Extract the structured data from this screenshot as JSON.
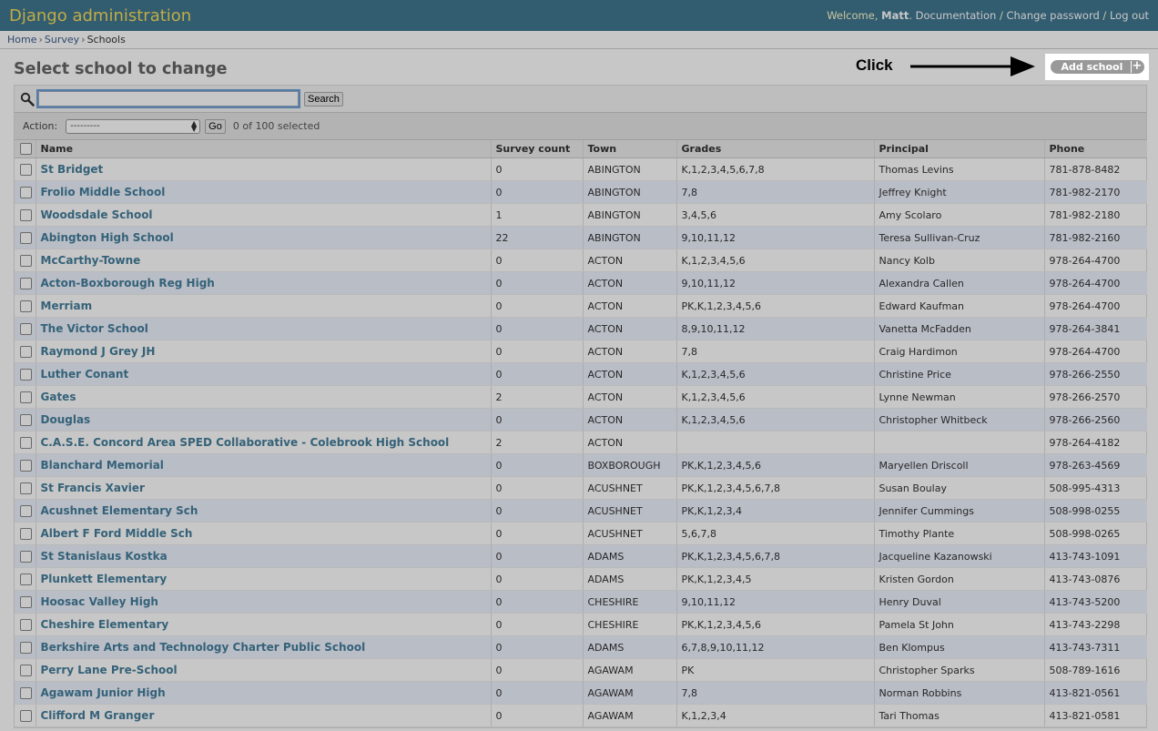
{
  "header": {
    "site_title": "Django administration",
    "welcome": "Welcome, ",
    "user": "Matt",
    "documentation": "Documentation",
    "change_password": "Change password",
    "logout": "Log out"
  },
  "breadcrumbs": {
    "home": "Home",
    "survey": "Survey",
    "current": "Schools"
  },
  "page_title": "Select school to change",
  "add_button": "Add school",
  "annotation": "Click",
  "search": {
    "value": "",
    "button": "Search"
  },
  "actions": {
    "label": "Action:",
    "selected": "---------",
    "go": "Go",
    "counter": "0 of 100 selected"
  },
  "columns": [
    "Name",
    "Survey count",
    "Town",
    "Grades",
    "Principal",
    "Phone"
  ],
  "rows": [
    [
      "St Bridget",
      "0",
      "ABINGTON",
      "K,1,2,3,4,5,6,7,8",
      "Thomas Levins",
      "781-878-8482"
    ],
    [
      "Frolio Middle School",
      "0",
      "ABINGTON",
      "7,8",
      "Jeffrey Knight",
      "781-982-2170"
    ],
    [
      "Woodsdale School",
      "1",
      "ABINGTON",
      "3,4,5,6",
      "Amy Scolaro",
      "781-982-2180"
    ],
    [
      "Abington High School",
      "22",
      "ABINGTON",
      "9,10,11,12",
      "Teresa Sullivan-Cruz",
      "781-982-2160"
    ],
    [
      "McCarthy-Towne",
      "0",
      "ACTON",
      "K,1,2,3,4,5,6",
      "Nancy Kolb",
      "978-264-4700"
    ],
    [
      "Acton-Boxborough Reg High",
      "0",
      "ACTON",
      "9,10,11,12",
      "Alexandra Callen",
      "978-264-4700"
    ],
    [
      "Merriam",
      "0",
      "ACTON",
      "PK,K,1,2,3,4,5,6",
      "Edward Kaufman",
      "978-264-4700"
    ],
    [
      "The Victor School",
      "0",
      "ACTON",
      "8,9,10,11,12",
      "Vanetta McFadden",
      "978-264-3841"
    ],
    [
      "Raymond J Grey JH",
      "0",
      "ACTON",
      "7,8",
      "Craig Hardimon",
      "978-264-4700"
    ],
    [
      "Luther Conant",
      "0",
      "ACTON",
      "K,1,2,3,4,5,6",
      "Christine Price",
      "978-266-2550"
    ],
    [
      "Gates",
      "2",
      "ACTON",
      "K,1,2,3,4,5,6",
      "Lynne Newman",
      "978-266-2570"
    ],
    [
      "Douglas",
      "0",
      "ACTON",
      "K,1,2,3,4,5,6",
      "Christopher Whitbeck",
      "978-266-2560"
    ],
    [
      "C.A.S.E. Concord Area SPED Collaborative - Colebrook High School",
      "2",
      "ACTON",
      "",
      "",
      "978-264-4182"
    ],
    [
      "Blanchard Memorial",
      "0",
      "BOXBOROUGH",
      "PK,K,1,2,3,4,5,6",
      "Maryellen Driscoll",
      "978-263-4569"
    ],
    [
      "St Francis Xavier",
      "0",
      "ACUSHNET",
      "PK,K,1,2,3,4,5,6,7,8",
      "Susan Boulay",
      "508-995-4313"
    ],
    [
      "Acushnet Elementary Sch",
      "0",
      "ACUSHNET",
      "PK,K,1,2,3,4",
      "Jennifer Cummings",
      "508-998-0255"
    ],
    [
      "Albert F Ford Middle Sch",
      "0",
      "ACUSHNET",
      "5,6,7,8",
      "Timothy Plante",
      "508-998-0265"
    ],
    [
      "St Stanislaus Kostka",
      "0",
      "ADAMS",
      "PK,K,1,2,3,4,5,6,7,8",
      "Jacqueline Kazanowski",
      "413-743-1091"
    ],
    [
      "Plunkett Elementary",
      "0",
      "ADAMS",
      "PK,K,1,2,3,4,5",
      "Kristen Gordon",
      "413-743-0876"
    ],
    [
      "Hoosac Valley High",
      "0",
      "CHESHIRE",
      "9,10,11,12",
      "Henry Duval",
      "413-743-5200"
    ],
    [
      "Cheshire Elementary",
      "0",
      "CHESHIRE",
      "PK,K,1,2,3,4,5,6",
      "Pamela St John",
      "413-743-2298"
    ],
    [
      "Berkshire Arts and Technology Charter Public School",
      "0",
      "ADAMS",
      "6,7,8,9,10,11,12",
      "Ben Klompus",
      "413-743-7311"
    ],
    [
      "Perry Lane Pre-School",
      "0",
      "AGAWAM",
      "PK",
      "Christopher Sparks",
      "508-789-1616"
    ],
    [
      "Agawam Junior High",
      "0",
      "AGAWAM",
      "7,8",
      "Norman Robbins",
      "413-821-0561"
    ],
    [
      "Clifford M Granger",
      "0",
      "AGAWAM",
      "K,1,2,3,4",
      "Tari Thomas",
      "413-821-0581"
    ]
  ]
}
